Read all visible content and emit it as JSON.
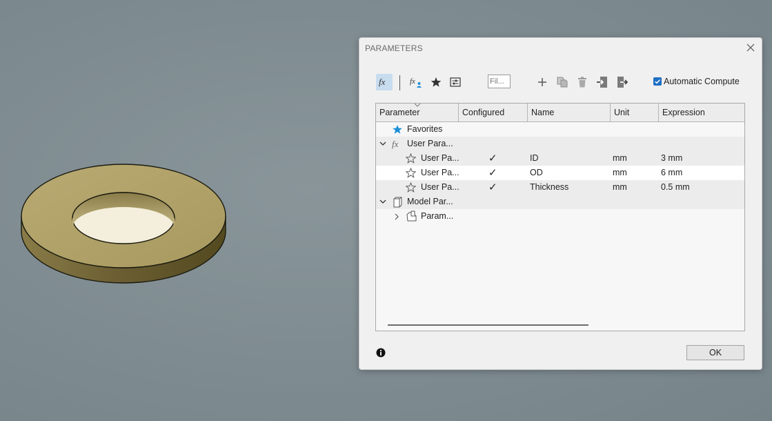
{
  "dialog": {
    "title": "PARAMETERS",
    "filter_placeholder": "Fil...",
    "auto_compute_label": "Automatic Compute",
    "auto_compute_checked": true,
    "ok_label": "OK"
  },
  "toolbar_icons": [
    "fx-icon",
    "user-parameter-icon",
    "favorite-star-icon",
    "settings-list-icon",
    "add-icon",
    "copy-icon",
    "delete-icon",
    "import-icon",
    "export-icon"
  ],
  "table": {
    "columns": [
      "Parameter",
      "Configured",
      "Name",
      "Unit",
      "Expression"
    ],
    "favorites_label": "Favorites",
    "user_group_label": "User Para...",
    "model_group_label": "Model Par...",
    "model_child_label": "Param...",
    "rows": [
      {
        "param": "User Pa...",
        "configured": "✓",
        "name": "ID",
        "unit": "mm",
        "expression": "3 mm"
      },
      {
        "param": "User Pa...",
        "configured": "✓",
        "name": "OD",
        "unit": "mm",
        "expression": "6 mm"
      },
      {
        "param": "User Pa...",
        "configured": "✓",
        "name": "Thickness",
        "unit": "mm",
        "expression": "0.5 mm"
      }
    ]
  },
  "colors": {
    "viewport_bg": "#808d92",
    "washer_top": "#b3a56b",
    "washer_side": "#6e6134",
    "accent_blue": "#1e6fc4",
    "favorites_star": "#1e8fd6"
  }
}
